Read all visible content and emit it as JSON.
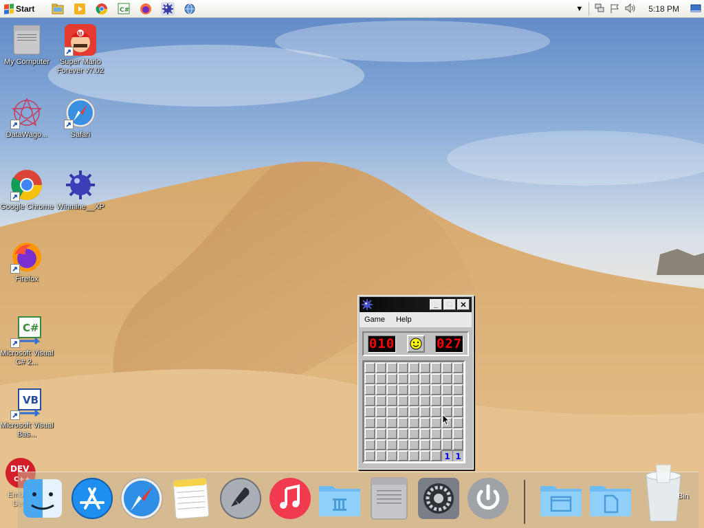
{
  "taskbar": {
    "start_label": "Start",
    "clock": "5:18 PM",
    "quick_launch": [
      "explorer-icon",
      "media-player-icon",
      "chrome-icon",
      "csharp-icon",
      "firefox-icon",
      "winmine-icon",
      "globe-icon"
    ]
  },
  "desktop": {
    "icons": [
      {
        "label": "My Computer",
        "icon": "computer-icon"
      },
      {
        "label": "Super Mario Forever v7.02",
        "icon": "mario-icon"
      },
      {
        "label": "DataWago...",
        "icon": "datawagon-icon"
      },
      {
        "label": "Safari",
        "icon": "safari-icon"
      },
      {
        "label": "Google Chrome",
        "icon": "chrome-icon"
      },
      {
        "label": "Winmine__XP",
        "icon": "winmine-icon"
      },
      {
        "label": "Firefox",
        "icon": "firefox-icon"
      },
      {
        "label": "Microsoft Visual C# 2...",
        "icon": "visual-csharp-icon"
      },
      {
        "label": "Microsoft Visual Bas...",
        "icon": "visual-basic-icon"
      },
      {
        "label": "Emba... De...",
        "icon": "devcpp-icon"
      },
      {
        "label": "Bin",
        "icon": "recycle-bin-icon"
      }
    ]
  },
  "minesweeper": {
    "menu": [
      "Game",
      "Help"
    ],
    "mines_counter": "010",
    "timer": "027",
    "revealed": [
      {
        "row": 8,
        "col": 7,
        "value": "1"
      },
      {
        "row": 8,
        "col": 8,
        "value": "1"
      }
    ],
    "rows": 9,
    "cols": 9
  },
  "dock": {
    "items": [
      "finder-icon",
      "app-store-icon",
      "safari-icon",
      "notes-icon",
      "launchpad-icon",
      "itunes-icon",
      "applications-folder-icon",
      "mac-pro-icon",
      "system-preferences-icon",
      "power-icon",
      "documents-folder-icon",
      "files-folder-icon",
      "trash-icon"
    ]
  },
  "colors": {
    "accent": "#0a0a0a",
    "led": "#ff0000",
    "number_one": "#0000ff"
  }
}
